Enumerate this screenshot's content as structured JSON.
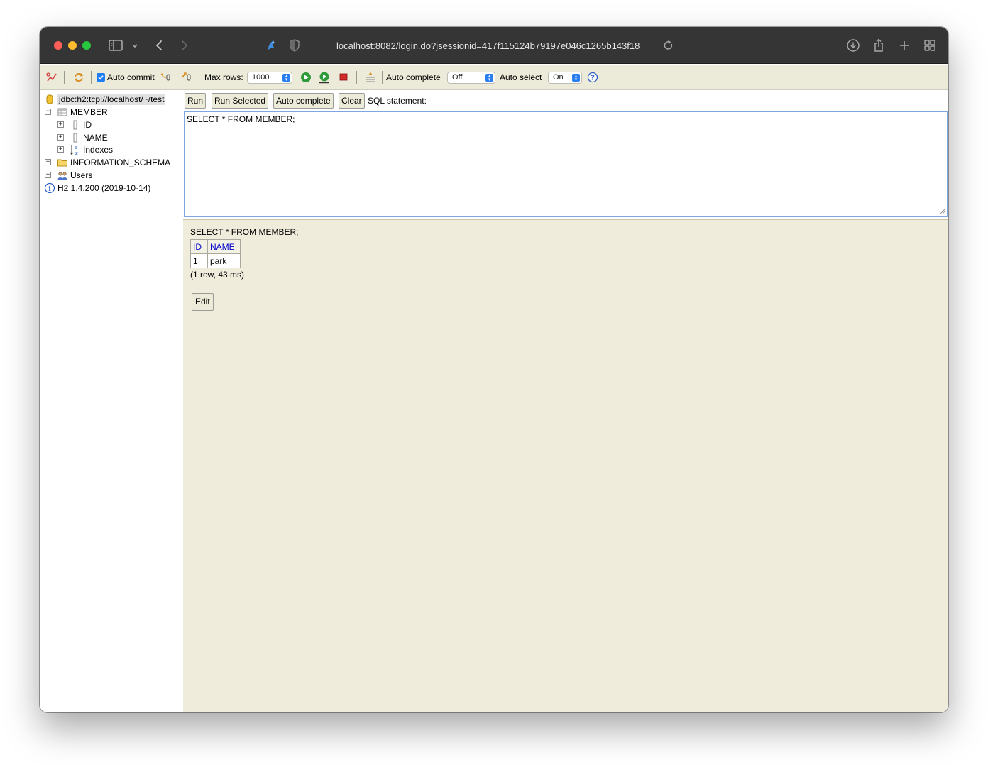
{
  "browser": {
    "url": "localhost:8082/login.do?jsessionid=417f115124b79197e046c1265b143f18",
    "icons": [
      "sidebar-icon",
      "chevron-down-icon",
      "back-icon",
      "forward-icon",
      "extension-icon",
      "shield-icon",
      "reload-icon",
      "download-icon",
      "share-icon",
      "new-tab-icon",
      "tab-overview-icon"
    ]
  },
  "toolbar": {
    "auto_commit_label": "Auto commit",
    "auto_commit_checked": true,
    "max_rows_label": "Max rows:",
    "max_rows_value": "1000",
    "auto_complete_label": "Auto complete",
    "auto_complete_value": "Off",
    "auto_select_label": "Auto select",
    "auto_select_value": "On"
  },
  "tree": {
    "connection": "jdbc:h2:tcp://localhost/~/test",
    "table": "MEMBER",
    "columns": [
      "ID",
      "NAME"
    ],
    "indexes": "Indexes",
    "schema": "INFORMATION_SCHEMA",
    "users": "Users",
    "version": "H2 1.4.200 (2019-10-14)"
  },
  "buttons": {
    "run": "Run",
    "run_selected": "Run Selected",
    "auto_complete": "Auto complete",
    "clear": "Clear",
    "sql_statement_label": "SQL statement:"
  },
  "editor": {
    "text": "SELECT * FROM MEMBER;"
  },
  "result": {
    "sql": "SELECT * FROM MEMBER;",
    "headers": [
      "ID",
      "NAME"
    ],
    "rows": [
      [
        "1",
        "park"
      ]
    ],
    "info": "(1 row, 43 ms)",
    "edit_label": "Edit"
  },
  "colors": {
    "toolbar_bg": "#ecead8",
    "result_bg": "#f0ecdc",
    "header_link": "#0000cc",
    "accent": "#1f7ef5"
  }
}
